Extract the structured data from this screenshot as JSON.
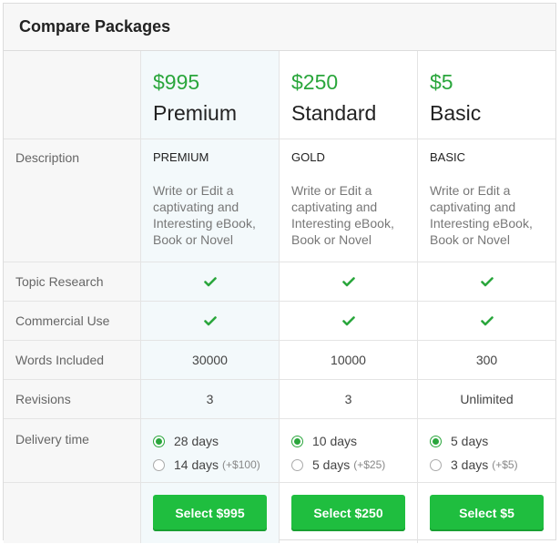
{
  "header": {
    "title": "Compare Packages"
  },
  "rows": {
    "description": "Description",
    "topic_research": "Topic Research",
    "commercial_use": "Commercial Use",
    "words_included": "Words Included",
    "revisions": "Revisions",
    "delivery_time": "Delivery time"
  },
  "packages": [
    {
      "price": "$995",
      "name": "Premium",
      "tier": "PREMIUM",
      "desc": "Write or Edit a captivating and Interesting eBook, Book or Novel",
      "topic_research": "check-icon",
      "commercial_use": "check-icon",
      "words": "30000",
      "revisions": "3",
      "delivery": [
        {
          "label": "28 days",
          "extra": "",
          "selected": true
        },
        {
          "label": "14 days",
          "extra": "(+$100)",
          "selected": false
        }
      ],
      "button": "Select $995"
    },
    {
      "price": "$250",
      "name": "Standard",
      "tier": "GOLD",
      "desc": "Write or Edit a captivating and Interesting eBook, Book or Novel",
      "topic_research": "check-icon",
      "commercial_use": "check-icon",
      "words": "10000",
      "revisions": "3",
      "delivery": [
        {
          "label": "10 days",
          "extra": "",
          "selected": true
        },
        {
          "label": "5 days",
          "extra": "(+$25)",
          "selected": false
        }
      ],
      "button": "Select $250"
    },
    {
      "price": "$5",
      "name": "Basic",
      "tier": "BASIC",
      "desc": "Write or Edit a captivating and Interesting eBook, Book or Novel",
      "topic_research": "check-icon",
      "commercial_use": "check-icon",
      "words": "300",
      "revisions": "Unlimited",
      "delivery": [
        {
          "label": "5 days",
          "extra": "",
          "selected": true
        },
        {
          "label": "3 days",
          "extra": "(+$5)",
          "selected": false
        }
      ],
      "button": "Select $5"
    }
  ],
  "colors": {
    "accent": "#2aa63c",
    "button": "#1fbe3f",
    "premium_bg": "#f3f9fb"
  }
}
